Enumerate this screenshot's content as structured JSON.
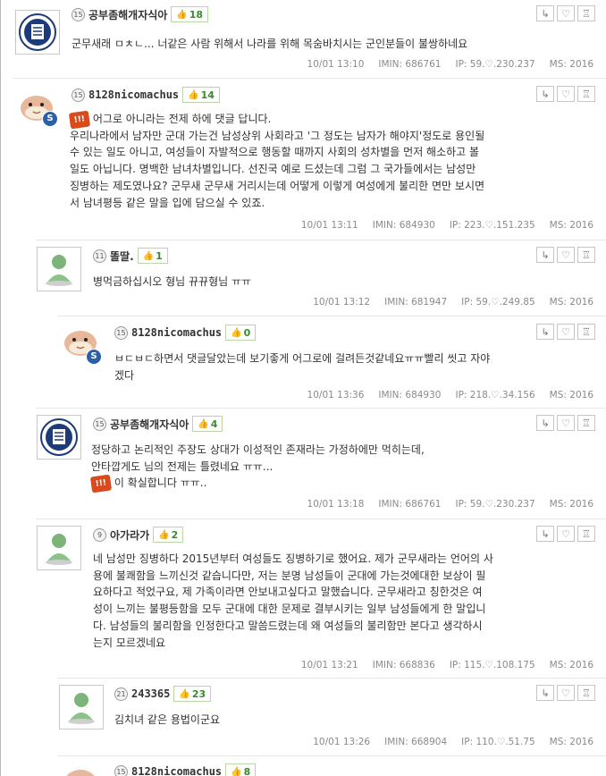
{
  "comments": [
    {
      "nick": "공부좀해개자식아",
      "level": "15",
      "likes": "18",
      "text": "군무새래 ㅁㅊㄴ... 너같은 사람 위해서 나라를 위해 목숨바치시는 군인분들이 불쌍하네요",
      "date": "10/01 13:10",
      "imin": "IMIN: 686761",
      "ip": "IP: 59.♡.230.237",
      "ms": "MS: 2016"
    },
    {
      "nick": "8128nicomachus",
      "level": "15",
      "likes": "14",
      "lines": [
        "어그로 아니라는 전제 하에 댓글 답니다.",
        "우리나라에서 남자만 군대 가는건 남성상위 사회라고 '그 정도는 남자가 해야지'정도로 용인될",
        "수 있는 일도 아니고, 여성들이 자발적으로 행동할 때까지 사회의 성차별을 먼저 해소하고 볼",
        "일도 아닙니다. 명백한 남녀차별입니다. 선진국 예로 드셨는데 그럼 그 국가들에서는 남성만",
        "징병하는 제도였나요? 군무새 군무새 거리시는데 어떻게 이렇게 여성에게 불리한 면만 보시면",
        "서 남녀평등 같은 말을 입에 담으실 수 있죠."
      ],
      "date": "10/01 13:11",
      "imin": "IMIN: 684930",
      "ip": "IP: 223.♡.151.235",
      "ms": "MS: 2016"
    },
    {
      "nick": "똘딸.",
      "level": "11",
      "likes": "1",
      "text": "병먹금하십시오 형님 뀨뀨형님 ㅠㅠ",
      "date": "10/01 13:12",
      "imin": "IMIN: 681947",
      "ip": "IP: 59.♡.249.85",
      "ms": "MS: 2016"
    },
    {
      "nick": "8128nicomachus",
      "level": "15",
      "likes": "0",
      "lines": [
        "ㅂㄷㅂㄷ하면서 댓글달았는데 보기좋게 어그로에 걸려든것같네요ㅠㅠ빨리 씻고 자야",
        "겠다"
      ],
      "date": "10/01 13:36",
      "imin": "IMIN: 684930",
      "ip": "IP: 218.♡.34.156",
      "ms": "MS: 2016"
    },
    {
      "nick": "공부좀해개자식아",
      "level": "15",
      "likes": "4",
      "lines": [
        "정당하고 논리적인 주장도 상대가 이성적인 존재라는 가정하에만 먹히는데,",
        "안타깝게도 님의 전제는 틀렸네요 ㅠㅠ...",
        "이 확실합니다 ㅠㅠ.."
      ],
      "date": "10/01 13:18",
      "imin": "IMIN: 686761",
      "ip": "IP: 59.♡.230.237",
      "ms": "MS: 2016"
    },
    {
      "nick": "아가라가",
      "level": "9",
      "likes": "2",
      "lines": [
        "네 남성만 징병하다 2015년부터 여성들도 징병하기로 했어요. 제가 군무새라는 언어의 사",
        "용에 불쾌함을 느끼신것 같습니다만, 저는 분명 남성들이 군대에 가는것에대한 보상이 필",
        "요하다고 적었구요, 제 가족이라면 안보내고싶다고 말했습니다. 군무새라고 칭한것은 여",
        "성이 느끼는 불평등함을 모두 군대에 대한 문제로 결부시키는 일부 남성들에게 한 말입니",
        "다. 남성들의 불리함을 인정한다고 말씀드렸는데 왜 여성들의 불리함만 본다고 생각하시",
        "는지 모르겠네요"
      ],
      "date": "10/01 13:21",
      "imin": "IMIN: 668836",
      "ip": "IP: 115.♡.108.175",
      "ms": "MS: 2016"
    },
    {
      "nick": "243365",
      "level": "21",
      "likes": "23",
      "text": "김치녀 같은 용법이군요",
      "date": "10/01 13:26",
      "imin": "IMIN: 668904",
      "ip": "IP: 110.♡.51.75",
      "ms": "MS: 2016"
    },
    {
      "nick": "8128nicomachus",
      "level": "15",
      "likes": "8"
    }
  ],
  "icons": {
    "reply": "reply-icon",
    "like": "heart-icon",
    "report": "siren-icon"
  },
  "colors": {
    "likes": "#3a8b2c",
    "badge_s": "#2d5fa8",
    "warn": "#d94a1c"
  },
  "badges": {
    "s": "S",
    "warn": "!!!"
  },
  "action_glyphs": {
    "reply": "↳",
    "like": "♡",
    "report": "♖"
  }
}
